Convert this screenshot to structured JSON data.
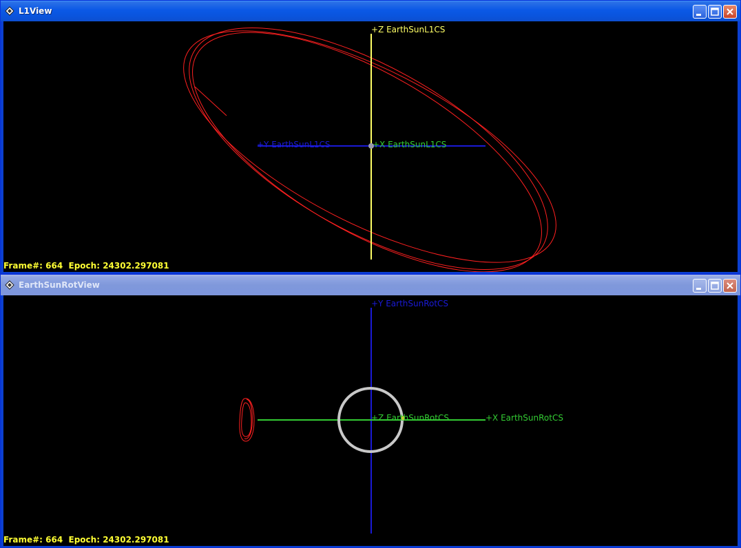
{
  "top_window": {
    "title": "L1View",
    "axis_labels": {
      "z": "+Z EarthSunL1CS",
      "y": "+Y EarthSunL1CS",
      "x": "+X EarthSunL1CS"
    },
    "status": "Frame#: 664  Epoch: 24302.297081"
  },
  "bottom_window": {
    "title": "EarthSunRotView",
    "axis_labels": {
      "y": "+Y EarthSunRotCS",
      "z": "+Z EarthSunRotCS",
      "x": "+X EarthSunRotCS"
    },
    "status": "Frame#: 664  Epoch: 24302.297081"
  },
  "icons": {
    "app": "app-diamond-icon",
    "minimize": "minimize-icon",
    "maximize": "maximize-icon",
    "close": "close-icon"
  },
  "colors": {
    "orbit": "#ff2020",
    "axis_z_top": "#ffff66",
    "axis_y": "#1a1ad6",
    "axis_x": "#33cc33",
    "earth_ring": "#c8c8c8",
    "status_text": "#ffff33",
    "xp_blue": "#0b59e6"
  }
}
